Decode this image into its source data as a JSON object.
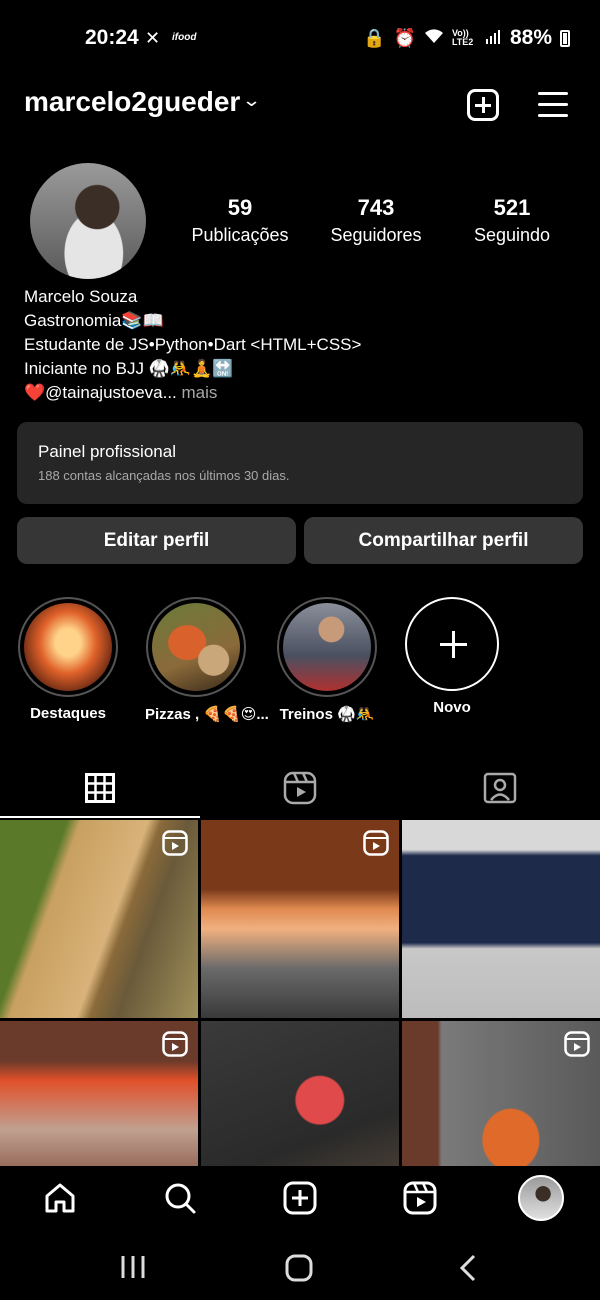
{
  "status_bar": {
    "time": "20:24",
    "notification_label": "ifood",
    "network_label": "Vo)) LTE2",
    "battery": "88%"
  },
  "header": {
    "username": "marcelo2gueder",
    "icons": [
      "chevron-down-icon",
      "add-box-icon",
      "menu-icon"
    ]
  },
  "profile": {
    "stats": [
      {
        "number": "59",
        "label": "Publicações"
      },
      {
        "number": "743",
        "label": "Seguidores"
      },
      {
        "number": "521",
        "label": "Seguindo"
      }
    ],
    "bio": {
      "name": "Marcelo Souza",
      "line1": "Gastronomia📚📖",
      "line2": "Estudante de  JS•Python•Dart <HTML+CSS>",
      "line3": "Iniciante no BJJ 🥋🤼🧘🔛",
      "line4": "❤️@tainajustoeva...",
      "more": " mais"
    }
  },
  "professional_panel": {
    "title": "Painel profissional",
    "subtitle": "188 contas alcançadas nos últimos 30 dias."
  },
  "buttons": {
    "edit": "Editar perfil",
    "share": "Compartilhar perfil"
  },
  "highlights": [
    {
      "label": "Destaques"
    },
    {
      "label": "Pizzas , 🍕🍕😍..."
    },
    {
      "label": "Treinos 🥋🤼"
    },
    {
      "label": "Novo"
    }
  ],
  "tabs": [
    "grid-icon",
    "reels-icon",
    "tagged-icon"
  ],
  "grid_posts": [
    {
      "kind": "reel",
      "subject": "railway path"
    },
    {
      "kind": "reel",
      "subject": "wood oven"
    },
    {
      "kind": "post",
      "subject": "screen video"
    },
    {
      "kind": "reel",
      "subject": "oven interior"
    },
    {
      "kind": "post",
      "subject": "book"
    },
    {
      "kind": "reel",
      "subject": "man at oven"
    }
  ],
  "bottom_nav": [
    "home-icon",
    "search-icon",
    "create-icon",
    "reels-icon",
    "profile-avatar"
  ]
}
